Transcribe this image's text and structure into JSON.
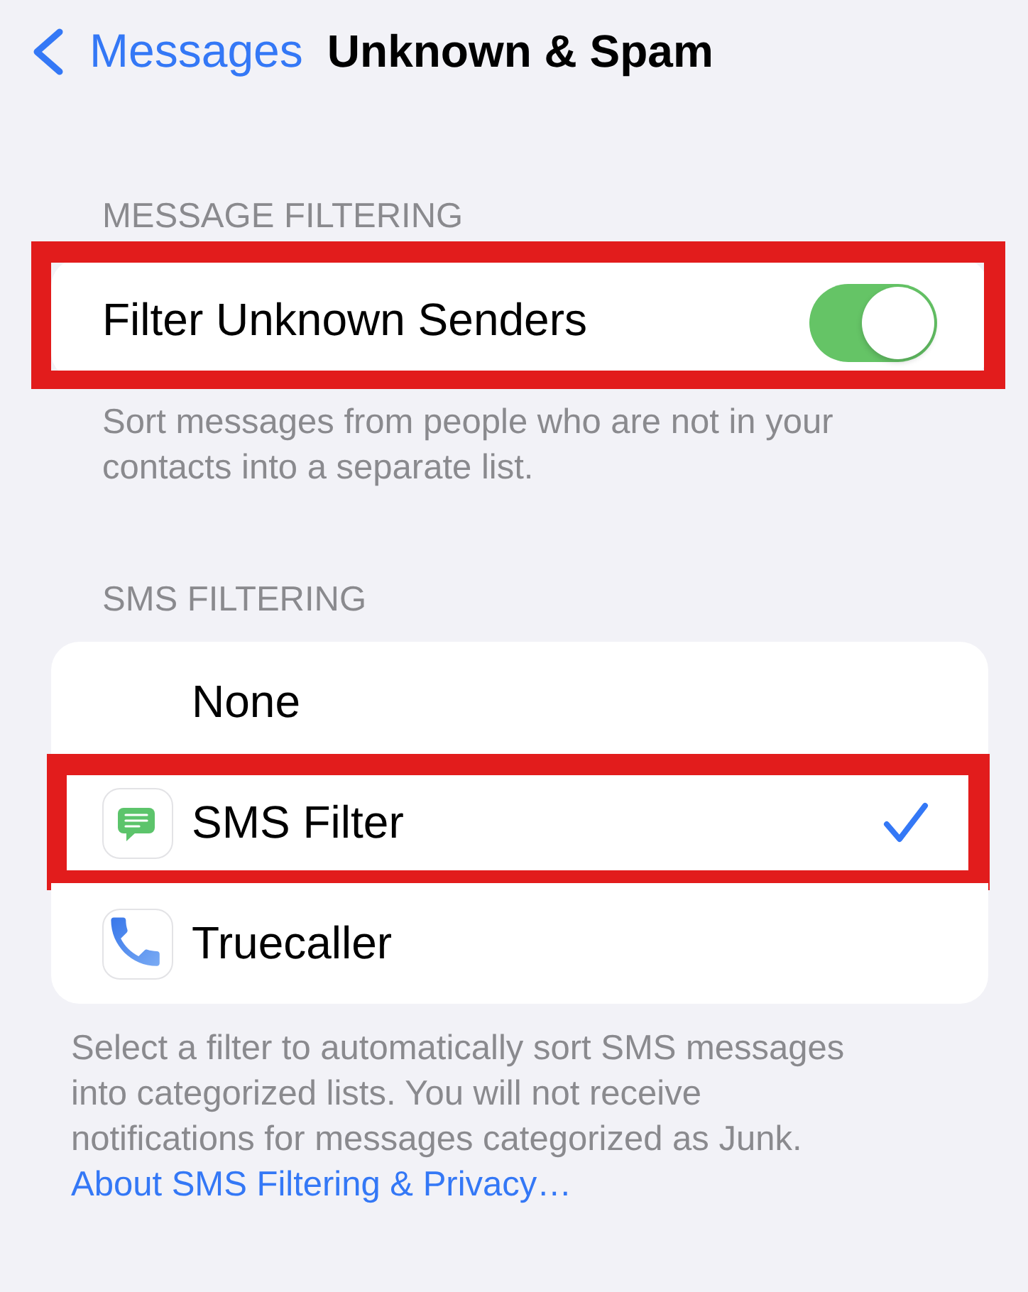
{
  "nav": {
    "back_label": "Messages",
    "title": "Unknown & Spam"
  },
  "message_filtering": {
    "header": "MESSAGE FILTERING",
    "rows": [
      {
        "label": "Filter Unknown Senders",
        "on": true,
        "highlighted": true
      }
    ],
    "footer": "Sort messages from people who are not in your contacts into a separate list."
  },
  "sms_filtering": {
    "header": "SMS FILTERING",
    "options": [
      {
        "kind": "plain",
        "label": "None",
        "selected": false,
        "highlighted": false
      },
      {
        "kind": "messaging",
        "label": "SMS Filter",
        "selected": true,
        "highlighted": true
      },
      {
        "kind": "calling",
        "label": "Truecaller",
        "selected": false,
        "highlighted": false
      }
    ],
    "footer": "Select a filter to automatically sort SMS messages into categorized lists. You will not receive notifications for messages categorized as Junk.",
    "link": "About SMS Filtering & Privacy…"
  }
}
